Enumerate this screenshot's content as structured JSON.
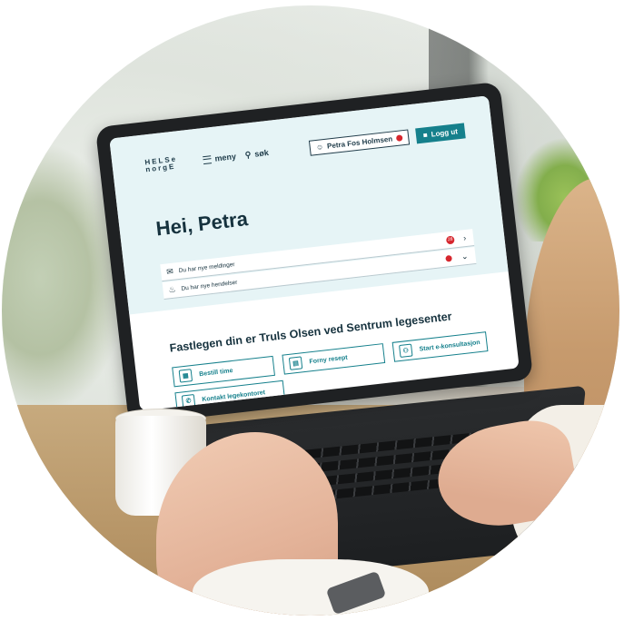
{
  "nav": {
    "logo_line1": "HELSe",
    "logo_line2": "norgE",
    "menu_label": "meny",
    "search_label": "søk",
    "user_label": "Petra Fos Holmsen",
    "logout_label": "Logg ut"
  },
  "hero": {
    "greeting": "Hei, Petra"
  },
  "notifications": [
    {
      "label": "Du har nye meldinger",
      "icon": "envelope-icon",
      "badge": "28",
      "chevron": "›"
    },
    {
      "label": "Du har nye hendelser",
      "icon": "bell-icon",
      "chevron": "⌄"
    }
  ],
  "doctor": {
    "title": "Fastlegen din er Truls Olsen ved Sentrum legesenter",
    "actions": [
      {
        "label": "Bestill time",
        "icon": "calendar-icon"
      },
      {
        "label": "Forny resept",
        "icon": "prescription-icon"
      },
      {
        "label": "Start e-konsultasjon",
        "icon": "doctor-icon"
      },
      {
        "label": "Kontakt legekontoret",
        "icon": "chat-icon"
      }
    ]
  },
  "colors": {
    "accent": "#15808c",
    "hero_bg": "#e6f4f6",
    "alert": "#d6262d",
    "text_dark": "#16323e"
  }
}
